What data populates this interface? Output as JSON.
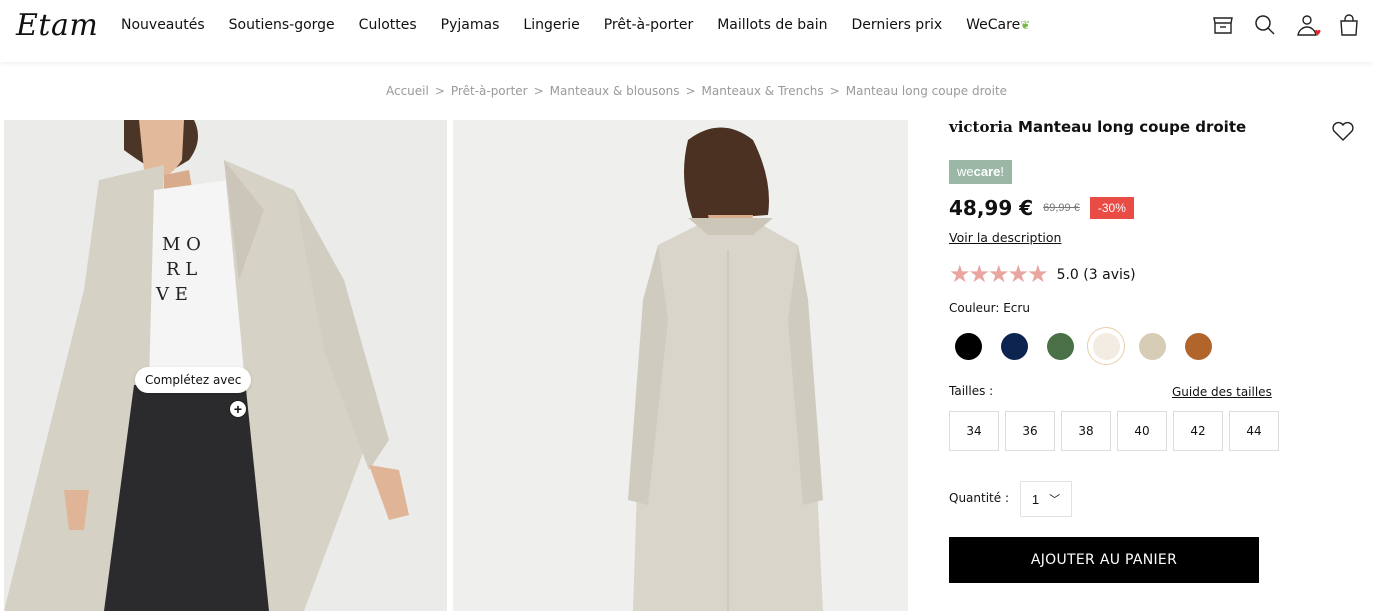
{
  "header": {
    "logo": "Etam",
    "nav": [
      "Nouveautés",
      "Soutiens-gorge",
      "Culottes",
      "Pyjamas",
      "Lingerie",
      "Prêt-à-porter",
      "Maillots de bain",
      "Derniers prix",
      "WeCare"
    ],
    "icons": [
      "store-icon",
      "search-icon",
      "account-icon",
      "bag-icon"
    ]
  },
  "breadcrumb": [
    "Accueil",
    "Prêt-à-porter",
    "Manteaux & blousons",
    "Manteaux & Trenchs",
    "Manteau long coupe droite"
  ],
  "gallery": {
    "complete_label": "Complétez avec",
    "tshirt_text": [
      "M O",
      "R L",
      "V E"
    ]
  },
  "product": {
    "brand": "victoria",
    "name": "Manteau long coupe droite",
    "badge_we": "we",
    "badge_care": "care",
    "badge_excl": "!",
    "price": "48,99 €",
    "old_price": "69,99 €",
    "discount": "-30%",
    "description_link": "Voir la description",
    "stars": "★★★★★",
    "rating": "5.0 (3 avis)",
    "color_label": "Couleur: Ecru",
    "colors": [
      "#000000",
      "#0d2451",
      "#4a7048",
      "#f2ece2",
      "#d7ccb5",
      "#b2652b"
    ],
    "sizes_label": "Tailles :",
    "size_guide": "Guide des tailles",
    "sizes": [
      "34",
      "36",
      "38",
      "40",
      "42",
      "44"
    ],
    "quantity_label": "Quantité :",
    "quantity_value": "1",
    "add_to_cart": "AJOUTER AU PANIER"
  }
}
